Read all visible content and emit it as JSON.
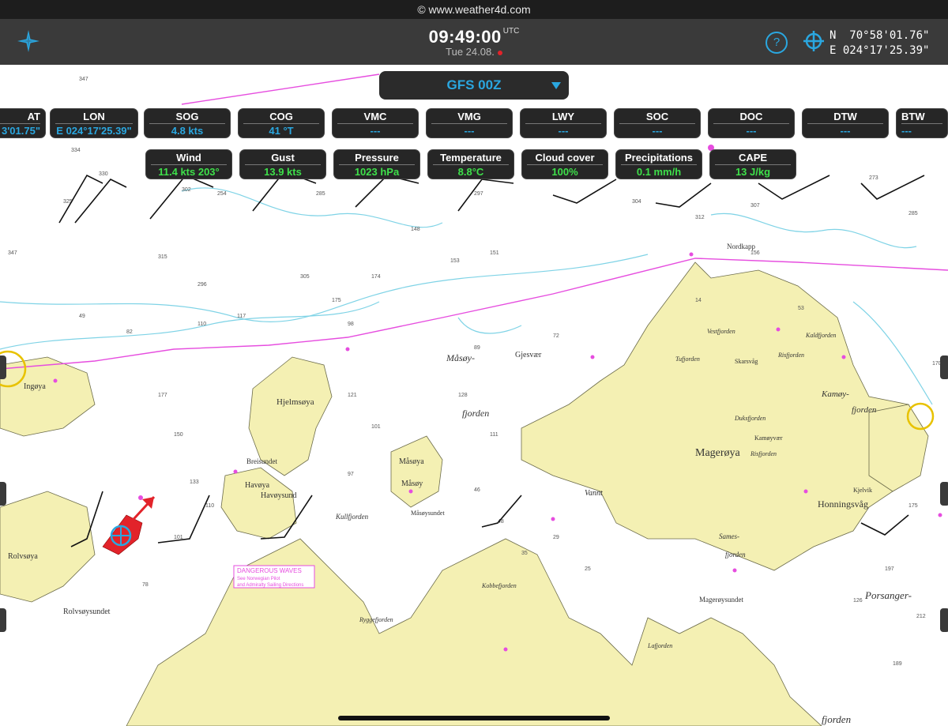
{
  "browser": {
    "url": "© www.weather4d.com"
  },
  "header": {
    "time": "09:49:00",
    "utc_label": "UTC",
    "date": "Tue 24.08.",
    "help_label": "?",
    "lat_line": "N  70°58'01.76\"",
    "lon_line": "E 024°17'25.39\""
  },
  "model": {
    "label": "GFS 00Z"
  },
  "nav_tiles": [
    {
      "label": "AT",
      "value": "3'01.75\""
    },
    {
      "label": "LON",
      "value": "E 024°17'25.39\""
    },
    {
      "label": "SOG",
      "value": "4.8 kts"
    },
    {
      "label": "COG",
      "value": "41 °T"
    },
    {
      "label": "VMC",
      "value": "---"
    },
    {
      "label": "VMG",
      "value": "---"
    },
    {
      "label": "LWY",
      "value": "---"
    },
    {
      "label": "SOC",
      "value": "---"
    },
    {
      "label": "DOC",
      "value": "---"
    },
    {
      "label": "DTW",
      "value": "---"
    },
    {
      "label": "BTW",
      "value": "---"
    }
  ],
  "weather_tiles": [
    {
      "label": "Wind",
      "value": "11.4 kts 203°"
    },
    {
      "label": "Gust",
      "value": "13.9 kts"
    },
    {
      "label": "Pressure",
      "value": "1023 hPa"
    },
    {
      "label": "Temperature",
      "value": "8.8°C"
    },
    {
      "label": "Cloud cover",
      "value": "100%"
    },
    {
      "label": "Precipitations",
      "value": "0.1 mm/h"
    },
    {
      "label": "CAPE",
      "value": "13 J/kg"
    }
  ],
  "map": {
    "places": {
      "magerøya": "Magerøya",
      "mågerøy_fjord_a": "Måsøy-",
      "mågerøy_fjord_b": "fjorden",
      "hjelmsøya": "Hjelmsøya",
      "havøya": "Havøya",
      "havøysund": "Havøysund",
      "måsøya": "Måsøya",
      "måsøy": "Måsøy",
      "ingøya": "Ingøya",
      "rolvsøya": "Rolvsøya",
      "rolvsøysundet": "Rolvsøysundet",
      "honningsvåg": "Honningsvåg",
      "kamøy": "Kamøy-",
      "kamøy_b": "fjorden",
      "porsanger": "Porsanger-",
      "porsanger_b": "fjorden",
      "nordkapp": "Nordkapp",
      "gjesvær": "Gjesvær",
      "vannt": "Vannt",
      "kullfjorden": "Kullfjorden",
      "breisundet": "Breisundet",
      "tufjorden": "Tufjorden",
      "skarsvåg": "Skarsvåg",
      "vestfjorden": "Vestfjorden",
      "kaldfjorden": "Kaldfjorden",
      "risfjorden": "Risfjorden",
      "duksfjorden": "Duksfjorden",
      "kamøyvær": "Kamøyvær",
      "risfjorden2": "Risfjorden",
      "mageroysundet": "Magerøysundet",
      "lafjorden": "Lafjorden",
      "kobbefjorden": "Kobbefjorden",
      "ryggefjorden": "Ryggefjorden",
      "måsøysundet": "Måsøysundet",
      "sames": "Sames-",
      "sames_b": "fjorden",
      "kjelvik": "Kjelvik"
    },
    "warning": {
      "title": "DANGEROUS WAVES",
      "line1": "See Norwegian Pilot",
      "line2": "and Admiralty Sailing Directions"
    },
    "colors": {
      "land": "#f4f0b3",
      "sea": "#ffffff",
      "shallow": "#d6ecf4",
      "route": "#e64ddf",
      "boat": "#e2232a"
    }
  }
}
